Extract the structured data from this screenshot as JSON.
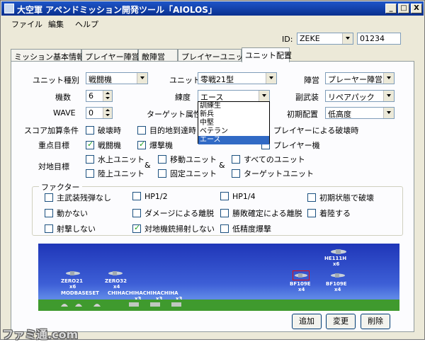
{
  "window": {
    "title": "大空軍 アペンドミッション開発ツール「AIOLOS」",
    "min_glyph": "_",
    "max_glyph": "□",
    "close_glyph": "X"
  },
  "menu": [
    "ファイル",
    "編集",
    "ヘルプ"
  ],
  "id_row": {
    "label": "ID:",
    "id_value": "ZEKE",
    "number_value": "01234"
  },
  "tabs": [
    "ミッション基本情報",
    "プレイヤー陣営",
    "敵陣営",
    "プレイヤーユニット",
    "ユニット配置"
  ],
  "form": {
    "unit_type": {
      "label": "ユニット種別",
      "value": "戦闘機"
    },
    "unit": {
      "label": "ユニット",
      "value": "零戦21型"
    },
    "faction": {
      "label": "陣営",
      "value": "プレーヤー陣営"
    },
    "count": {
      "label": "機数",
      "value": "6"
    },
    "skill": {
      "label": "練度",
      "value": "エース"
    },
    "sub_weapon": {
      "label": "副武装",
      "value": "リペアパック"
    },
    "wave": {
      "label": "WAVE",
      "value": "0"
    },
    "target_attr": {
      "label": "ターゲット属性"
    },
    "initial_position": {
      "label": "初期配置",
      "value": "低高度"
    },
    "skill_options": [
      "訓練生",
      "新兵",
      "中堅",
      "ベテラン",
      "エース"
    ]
  },
  "score_condition": {
    "label": "スコア加算条件",
    "items": [
      {
        "label": "破壊時",
        "checked": false
      },
      {
        "label": "目的地到達時",
        "checked": false
      },
      {
        "label": "プレイヤーによる破壊時",
        "checked": false
      }
    ]
  },
  "priority_target": {
    "label": "重点目標",
    "items": [
      {
        "label": "戦闘機",
        "checked": true
      },
      {
        "label": "爆撃機",
        "checked": true
      },
      {
        "label": "プレイヤー機",
        "checked": false
      }
    ]
  },
  "ground_target": {
    "label": "対地目標",
    "amp": "&",
    "col1": [
      {
        "label": "水上ユニット",
        "checked": false
      },
      {
        "label": "陸上ユニット",
        "checked": false
      }
    ],
    "col2": [
      {
        "label": "移動ユニット",
        "checked": false
      },
      {
        "label": "固定ユニット",
        "checked": false
      }
    ],
    "col3": [
      {
        "label": "すべてのユニット",
        "checked": false
      },
      {
        "label": "ターゲットユニット",
        "checked": false
      }
    ]
  },
  "factors": {
    "title": "ファクター",
    "items": [
      {
        "label": "主武装残弾なし",
        "checked": false
      },
      {
        "label": "HP1/2",
        "checked": false
      },
      {
        "label": "HP1/4",
        "checked": false
      },
      {
        "label": "初期状態で破壊",
        "checked": false
      },
      {
        "label": "動かない",
        "checked": false
      },
      {
        "label": "ダメージによる離脱",
        "checked": false
      },
      {
        "label": "勝敗確定による離脱",
        "checked": false
      },
      {
        "label": "着陸する",
        "checked": false
      },
      {
        "label": "射撃しない",
        "checked": false
      },
      {
        "label": "対地機銃掃射しない",
        "checked": true
      },
      {
        "label": "低精度爆撃",
        "checked": false
      }
    ]
  },
  "scene": {
    "units": [
      {
        "name": "ZERO21",
        "count": "x6"
      },
      {
        "name": "ZERO32",
        "count": "x4"
      },
      {
        "name": "HE111H",
        "count": "x6"
      },
      {
        "name": "BF109E",
        "count": "x4"
      },
      {
        "name": "BF109E",
        "count": "x4"
      }
    ],
    "ground_labels": [
      "MODBASESET",
      "CHIHACHIHACHIHACHIHA"
    ],
    "ground_counts": [
      "x3",
      "x3",
      "x3"
    ]
  },
  "buttons": {
    "add": "追加",
    "change": "変更",
    "delete": "削除"
  },
  "watermark": "ファミ通.com"
}
